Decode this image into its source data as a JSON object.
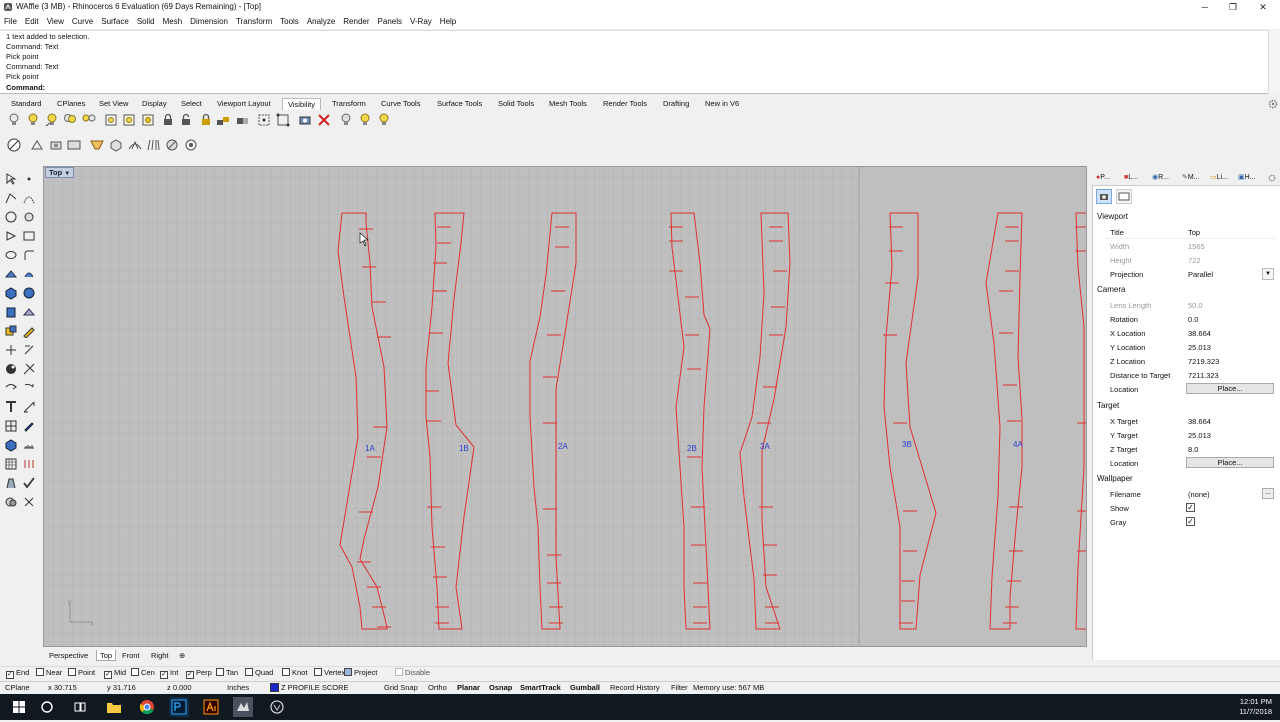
{
  "window": {
    "title": "WAffle (3 MB) - Rhinoceros 6 Evaluation (69 Days Remaining) - [Top]",
    "minimize": "─",
    "maximize": "❐",
    "close": "✕"
  },
  "menu": [
    "File",
    "Edit",
    "View",
    "Curve",
    "Surface",
    "Solid",
    "Mesh",
    "Dimension",
    "Transform",
    "Tools",
    "Analyze",
    "Render",
    "Panels",
    "V-Ray",
    "Help"
  ],
  "command_history": [
    "1 text added to selection.",
    "Command: Text",
    "Pick point",
    "Command: Text",
    "Pick point"
  ],
  "command_prompt": "Command:",
  "toolbar_tabs": [
    "Standard",
    "CPlanes",
    "Set View",
    "Display",
    "Select",
    "Viewport Layout",
    "Visibility",
    "Transform",
    "Curve Tools",
    "Surface Tools",
    "Solid Tools",
    "Mesh Tools",
    "Render Tools",
    "Drafting",
    "New in V6"
  ],
  "active_toolbar_tab": "Visibility",
  "viewport": {
    "label": "Top",
    "axis_x": "x",
    "axis_y": "y",
    "part_labels": [
      "1A",
      "1B",
      "2A",
      "2B",
      "3A",
      "3B",
      "4A"
    ]
  },
  "viewport_tabs": [
    "Perspective",
    "Top",
    "Front",
    "Right"
  ],
  "viewport_tab_add": "⊕",
  "active_viewport_tab": "Top",
  "panel": {
    "tabs": [
      "P...",
      "L...",
      "R...",
      "M...",
      "Li...",
      "H..."
    ],
    "sections": {
      "viewport": "Viewport",
      "camera": "Camera",
      "target": "Target",
      "wallpaper": "Wallpaper"
    },
    "viewport_props": [
      {
        "label": "Title",
        "value": "Top"
      },
      {
        "label": "Width",
        "value": "1565"
      },
      {
        "label": "Height",
        "value": "722"
      },
      {
        "label": "Projection",
        "value": "Parallel"
      }
    ],
    "camera_props": [
      {
        "label": "Lens Length",
        "value": "50.0"
      },
      {
        "label": "Rotation",
        "value": "0.0"
      },
      {
        "label": "X Location",
        "value": "38.664"
      },
      {
        "label": "Y Location",
        "value": "25.013"
      },
      {
        "label": "Z Location",
        "value": "7219.323"
      },
      {
        "label": "Distance to Target",
        "value": "7211.323"
      },
      {
        "label": "Location",
        "value": "Place..."
      }
    ],
    "target_props": [
      {
        "label": "X Target",
        "value": "38.664"
      },
      {
        "label": "Y Target",
        "value": "25.013"
      },
      {
        "label": "Z Target",
        "value": "8.0"
      },
      {
        "label": "Location",
        "value": "Place..."
      }
    ],
    "wallpaper_props": [
      {
        "label": "Filename",
        "value": "(none)"
      },
      {
        "label": "Show",
        "value": "✓"
      },
      {
        "label": "Gray",
        "value": "✓"
      }
    ],
    "filename_browse": "..."
  },
  "osnap": [
    {
      "label": "End",
      "checked": true
    },
    {
      "label": "Near",
      "checked": false
    },
    {
      "label": "Point",
      "checked": false
    },
    {
      "label": "Mid",
      "checked": true
    },
    {
      "label": "Cen",
      "checked": false
    },
    {
      "label": "Int",
      "checked": true
    },
    {
      "label": "Perp",
      "checked": true
    },
    {
      "label": "Tan",
      "checked": false
    },
    {
      "label": "Quad",
      "checked": false
    },
    {
      "label": "Knot",
      "checked": false
    },
    {
      "label": "Vertex",
      "checked": false
    },
    {
      "label": "Project",
      "checked": false
    },
    {
      "label": "Disable",
      "checked": false
    }
  ],
  "checkmark": "✓",
  "status": {
    "cplane": "CPlane",
    "x": "x 30.715",
    "y": "y 31.716",
    "z": "z 0.000",
    "units": "Inches",
    "layer": "Z PROFILE SCORE",
    "layer_color": "#1c27c8",
    "toggles": [
      "Grid Snap",
      "Ortho",
      "Planar",
      "Osnap",
      "SmartTrack",
      "Gumball",
      "Record History",
      "Filter"
    ],
    "memory": "Memory use: 567 MB"
  },
  "clock": {
    "time": "12:01 PM",
    "date": "11/7/2018"
  },
  "colors": {
    "curve": "#e03030",
    "label": "#2b3fd0",
    "grid": "#a9a9a9",
    "viewport_bg": "#bfbfbf"
  }
}
